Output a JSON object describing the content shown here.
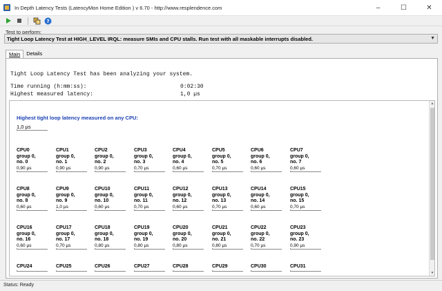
{
  "window": {
    "title": "In Depth Latency Tests  (LatencyMon Home Edition )  v 6.70 - http://www.resplendence.com",
    "minimize": "–",
    "maximize": "☐",
    "close": "✕"
  },
  "toolbar": {
    "icons": [
      "play-icon",
      "stop-icon",
      "windows-icon",
      "help-icon"
    ]
  },
  "test": {
    "label": "Test to perform:",
    "selected": "Tight Loop Latency Test at HIGH_LEVEL IRQL:  measure SMIs and CPU stalls. Run test with all maskable interrupts disabled."
  },
  "tabs": [
    {
      "label": "Main",
      "active": true
    },
    {
      "label": "Details",
      "active": false
    }
  ],
  "summary": {
    "title": "Tight Loop Latency Test has been analyzing your system.",
    "time_label": "Time running (h:mm:ss):",
    "time_value": "0:02:30",
    "highest_label": "Highest measured latency:",
    "highest_value": "1,0 µs"
  },
  "highest": {
    "label": "Highest tight loop latency measured on any CPU:",
    "value": "1,0 µs"
  },
  "cpus": [
    {
      "name": "CPU0",
      "group": "group 0,",
      "no": "no. 0",
      "latency": "0,90 µs"
    },
    {
      "name": "CPU1",
      "group": "group 0,",
      "no": "no. 1",
      "latency": "0,90 µs"
    },
    {
      "name": "CPU2",
      "group": "group 0,",
      "no": "no. 2",
      "latency": "0,90 µs"
    },
    {
      "name": "CPU3",
      "group": "group 0,",
      "no": "no. 3",
      "latency": "0,70 µs"
    },
    {
      "name": "CPU4",
      "group": "group 0,",
      "no": "no. 4",
      "latency": "0,60 µs"
    },
    {
      "name": "CPU5",
      "group": "group 0,",
      "no": "no. 5",
      "latency": "0,70 µs"
    },
    {
      "name": "CPU6",
      "group": "group 0,",
      "no": "no. 6",
      "latency": "0,60 µs"
    },
    {
      "name": "CPU7",
      "group": "group 0,",
      "no": "no. 7",
      "latency": "0,60 µs"
    },
    {
      "name": "CPU8",
      "group": "group 0,",
      "no": "no. 8",
      "latency": "0,60 µs"
    },
    {
      "name": "CPU9",
      "group": "group 0,",
      "no": "no. 9",
      "latency": "1,0 µs"
    },
    {
      "name": "CPU10",
      "group": "group 0,",
      "no": "no. 10",
      "latency": "0,60 µs"
    },
    {
      "name": "CPU11",
      "group": "group 0,",
      "no": "no. 11",
      "latency": "0,70 µs"
    },
    {
      "name": "CPU12",
      "group": "group 0,",
      "no": "no. 12",
      "latency": "0,60 µs"
    },
    {
      "name": "CPU13",
      "group": "group 0,",
      "no": "no. 13",
      "latency": "0,70 µs"
    },
    {
      "name": "CPU14",
      "group": "group 0,",
      "no": "no. 14",
      "latency": "0,60 µs"
    },
    {
      "name": "CPU15",
      "group": "group 0,",
      "no": "no. 15",
      "latency": "0,70 µs"
    },
    {
      "name": "CPU16",
      "group": "group 0,",
      "no": "no. 16",
      "latency": "0,60 µs"
    },
    {
      "name": "CPU17",
      "group": "group 0,",
      "no": "no. 17",
      "latency": "0,70 µs"
    },
    {
      "name": "CPU18",
      "group": "group 0,",
      "no": "no. 18",
      "latency": "0,80 µs"
    },
    {
      "name": "CPU19",
      "group": "group 0,",
      "no": "no. 19",
      "latency": "0,80 µs"
    },
    {
      "name": "CPU20",
      "group": "group 0,",
      "no": "no. 20",
      "latency": "0,80 µs"
    },
    {
      "name": "CPU21",
      "group": "group 0,",
      "no": "no. 21",
      "latency": "0,80 µs"
    },
    {
      "name": "CPU22",
      "group": "group 0,",
      "no": "no. 22",
      "latency": "0,70 µs"
    },
    {
      "name": "CPU23",
      "group": "group 0,",
      "no": "no. 23",
      "latency": "0,90 µs"
    },
    {
      "name": "CPU24",
      "group": "",
      "no": "",
      "latency": ""
    },
    {
      "name": "CPU25",
      "group": "",
      "no": "",
      "latency": ""
    },
    {
      "name": "CPU26",
      "group": "",
      "no": "",
      "latency": ""
    },
    {
      "name": "CPU27",
      "group": "",
      "no": "",
      "latency": ""
    },
    {
      "name": "CPU28",
      "group": "",
      "no": "",
      "latency": ""
    },
    {
      "name": "CPU29",
      "group": "",
      "no": "",
      "latency": ""
    },
    {
      "name": "CPU30",
      "group": "",
      "no": "",
      "latency": ""
    },
    {
      "name": "CPU31",
      "group": "",
      "no": "",
      "latency": ""
    }
  ],
  "status": {
    "text": "Status: Ready"
  }
}
